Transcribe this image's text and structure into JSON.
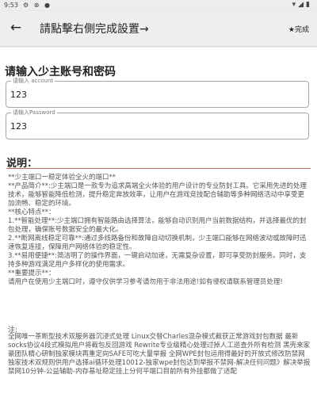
{
  "status_bar": {
    "time": "9:53",
    "icons": "⚙ ⊗ ●"
  },
  "appbar": {
    "back_icon": "back-arrow-icon",
    "title": "請點擊右側完成設置→",
    "action_label": "★完成"
  },
  "login": {
    "section_title": "请输入少主账号和密码",
    "account": {
      "label": "请输入 account",
      "value": "123"
    },
    "password": {
      "label": "请输入Password",
      "value": "123"
    }
  },
  "description": {
    "heading": "说明：",
    "lines": [
      "**少主端口一稳定体验全火的端口**",
      "**产品简介**:少主端口是一款专为追求高端全火体验的用户设计的专业防封工具。它采用先进的处理技术，能够智能降低检测，提升稳定奔放效率，让用户在游戏竞技配合辅助等多种网络活动中享受更加流畅、稳定的环境。",
      "**核心特点**：",
      "1.**智能处理**:少主端口拥有智能路由选择算法，能够自动识别用户当前数据结构，并选择最优的封包处理，确保账号数据安全的最大化。",
      "2.**断网离线稳定可靠**:通过多线路备份和故障自动切换机制，少主端口能够在网络波动或故障时迅速恢复连接，保障用户网络体验的稳定性。",
      "3.**易用便捷**:简洁明了的操作界面，一键启动加速，无需复杂设置，即可享受防封服务。同时，支持多种游戏满足用户多样化的使用需求。",
      "**重要提示**：",
      "请用户在使用少主端口时，遵守仅供学习参考请勿用于非法用途!如有侵权请联系管理员处理!"
    ],
    "note_label": "注:",
    "note": "全网唯一茶断型技术双服务器沉浸式处理 Linux交替Charles混杂模式截获正常游戏封包数据 最新socks协议4段式模拟用户将截包反回游戏 Rewrite专业级精心处理过掉人工巡查外所有检测 黑壳来家豪团队精心研制独家模块再重定向SAFE可吃大量举报 全网WPE封包运用得最好的开放式修改防禁网 独家技术双规则供用户选择ai循环处理10012-独家wpe封包达到举报不禁网-解决任何问题》解决举报禁网10分钟-公益辅助-内存基址稳定挂上分何平端口目前所有外挂都做了适配"
  }
}
